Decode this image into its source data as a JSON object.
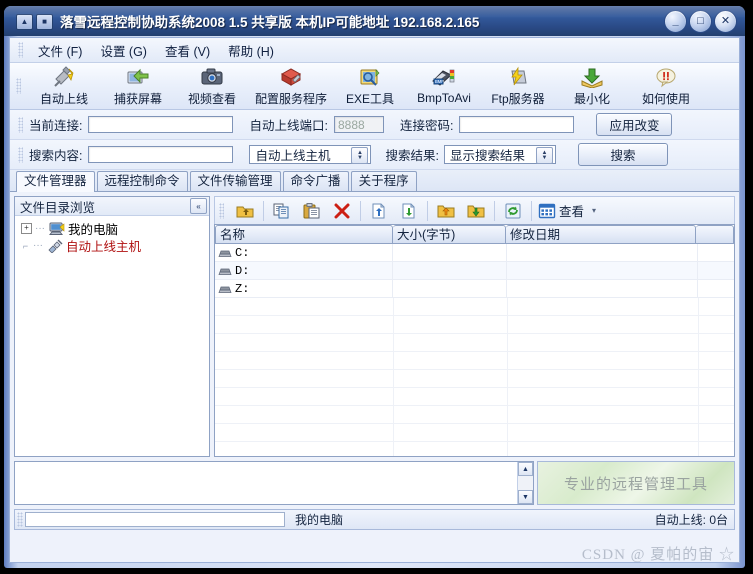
{
  "window": {
    "title": "落雪远程控制协助系统2008 1.5 共享版  本机IP可能地址 192.168.2.165",
    "sq_btn1": "▲",
    "sq_btn2": "■",
    "minimize": "_",
    "maximize": "□",
    "close": "✕"
  },
  "menu": [
    {
      "label": "文件 (F)"
    },
    {
      "label": "设置 (G)"
    },
    {
      "label": "查看 (V)"
    },
    {
      "label": "帮助 (H)"
    }
  ],
  "toolbar": [
    {
      "label": "自动上线",
      "icon": "auto-connect-icon"
    },
    {
      "label": "捕获屏幕",
      "icon": "screen-capture-icon"
    },
    {
      "label": "视频查看",
      "icon": "camera-icon"
    },
    {
      "label": "配置服务程序",
      "icon": "server-config-icon"
    },
    {
      "label": "EXE工具",
      "icon": "exe-tool-icon"
    },
    {
      "label": "BmpToAvi",
      "icon": "bmp-to-avi-icon"
    },
    {
      "label": "Ftp服务器",
      "icon": "ftp-server-icon"
    },
    {
      "label": "最小化",
      "icon": "minimize-arrow-icon"
    },
    {
      "label": "如何使用",
      "icon": "help-bubble-icon"
    }
  ],
  "form": {
    "current_conn_label": "当前连接:",
    "current_conn_value": "",
    "port_label": "自动上线端口:",
    "port_value": "8888",
    "password_label": "连接密码:",
    "password_value": "",
    "apply_button": "应用改变",
    "search_label": "搜索内容:",
    "search_value": "",
    "search_scope": "自动上线主机",
    "result_label": "搜索结果:",
    "result_mode": "显示搜索结果",
    "search_button": "搜索"
  },
  "tabs": [
    {
      "label": "文件管理器",
      "active": true
    },
    {
      "label": "远程控制命令",
      "active": false
    },
    {
      "label": "文件传输管理",
      "active": false
    },
    {
      "label": "命令广播",
      "active": false
    },
    {
      "label": "关于程序",
      "active": false
    }
  ],
  "tree_panel": {
    "header": "文件目录浏览",
    "collapse": "«",
    "nodes": [
      {
        "label": "我的电脑",
        "expander": "+",
        "red": false,
        "icon": "computer-icon"
      },
      {
        "label": "自动上线主机",
        "expander": "",
        "red": true,
        "icon": "plug-icon"
      }
    ]
  },
  "file_toolbar": [
    {
      "name": "up-folder-icon",
      "title": "上级目录"
    },
    {
      "name": "copy-icon",
      "title": "复制"
    },
    {
      "name": "paste-icon",
      "title": "粘贴"
    },
    {
      "name": "delete-icon",
      "title": "删除"
    },
    {
      "name": "upload-file-icon",
      "title": "上传文件"
    },
    {
      "name": "download-file-icon",
      "title": "下载文件"
    },
    {
      "name": "upload-folder-icon",
      "title": "上传目录"
    },
    {
      "name": "download-folder-icon",
      "title": "下载目录"
    },
    {
      "name": "refresh-icon",
      "title": "刷新"
    }
  ],
  "file_view": {
    "label": "查看",
    "dropdown": "▾"
  },
  "file_list": {
    "columns": [
      "名称",
      "大小(字节)",
      "修改日期",
      ""
    ],
    "rows": [
      {
        "name": "C:",
        "size": "",
        "date": ""
      },
      {
        "name": "D:",
        "size": "",
        "date": ""
      },
      {
        "name": "Z:",
        "size": "",
        "date": ""
      }
    ]
  },
  "log": {
    "content": "",
    "scroll_up": "▲",
    "scroll_down": "▼"
  },
  "banner": {
    "text": "专业的远程管理工具"
  },
  "status": {
    "field_value": "",
    "text": "我的电脑",
    "right_text": "自动上线: 0台"
  },
  "watermark": {
    "text": "CSDN @ 夏帕的宙 ☆"
  },
  "colors": {
    "titlebar": "#2c4d8c",
    "client_bg": "#eef2fb",
    "accent_red": "#b01010",
    "banner_green": "#d8ebcc"
  }
}
